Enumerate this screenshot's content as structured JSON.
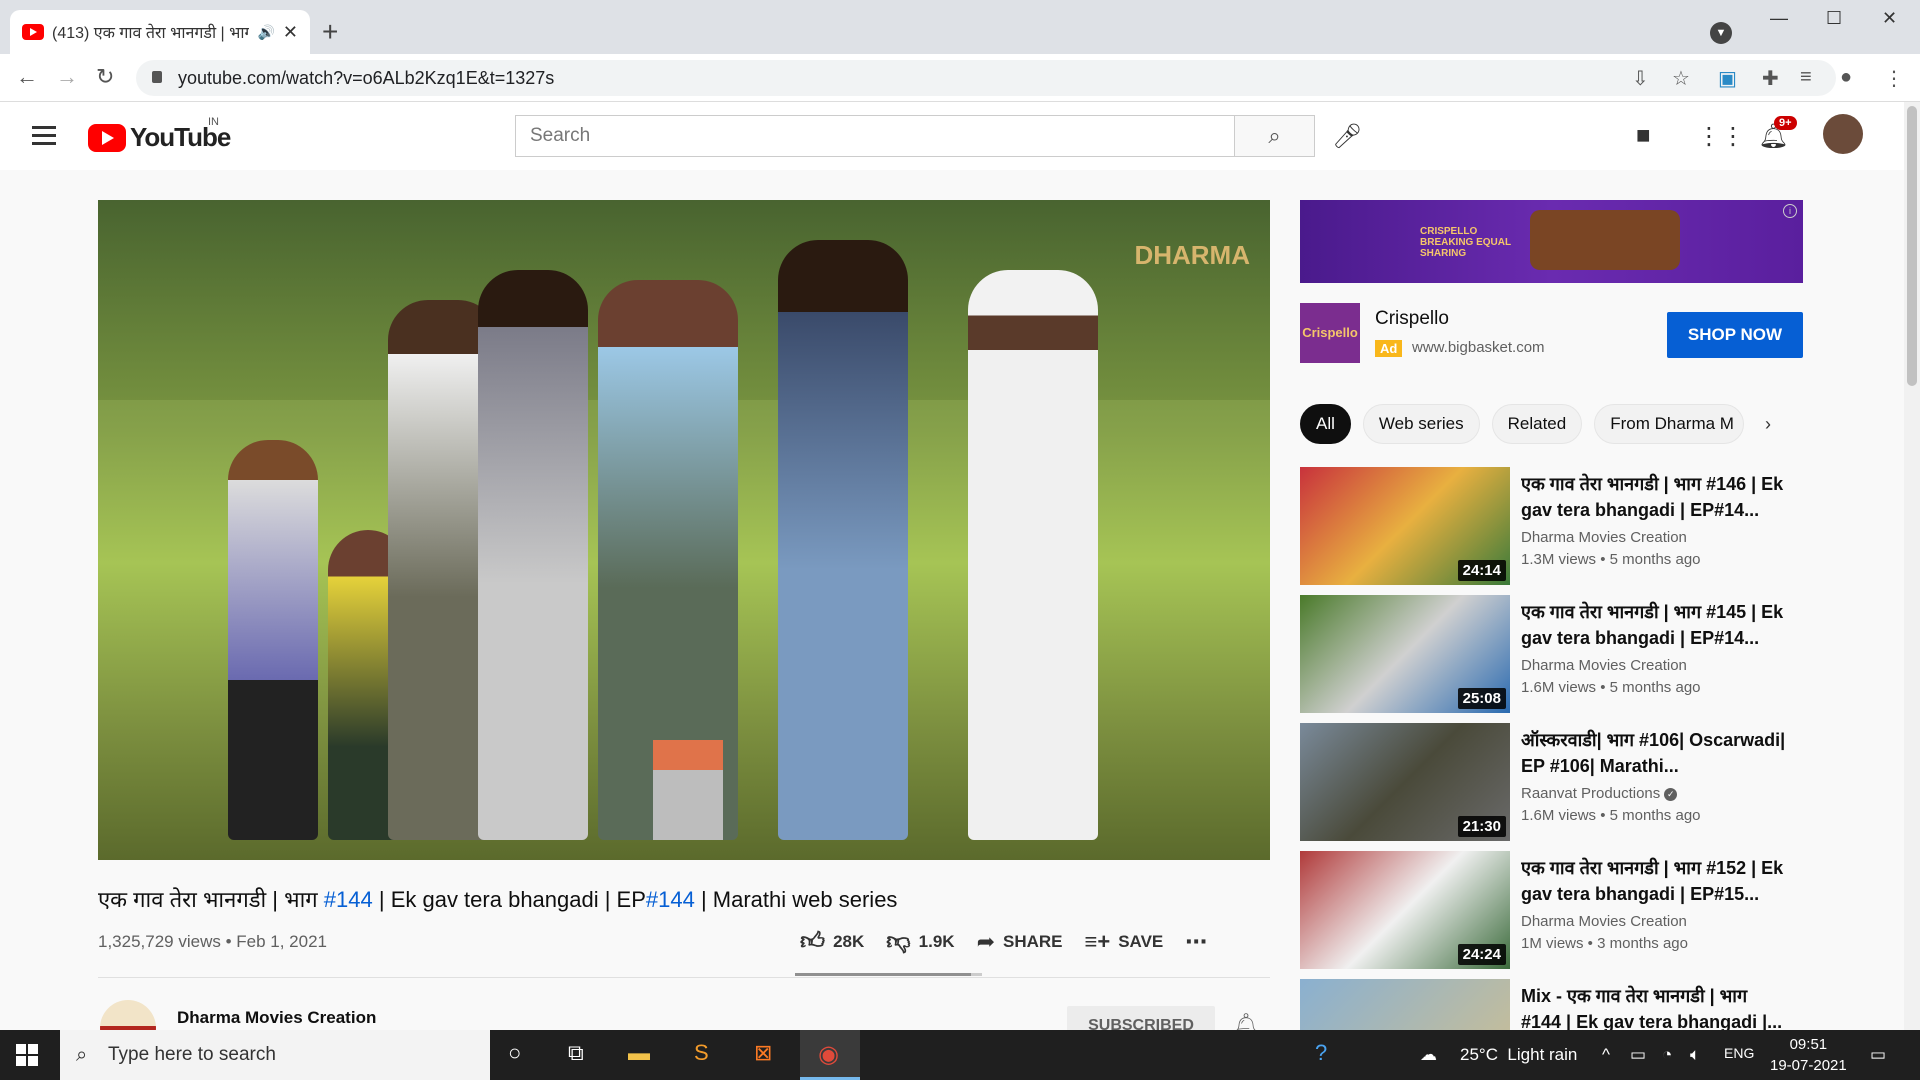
{
  "browser": {
    "tab_title": "(413) एक गाव तेरा भानगडी | भाग",
    "url": "youtube.com/watch?v=o6ALb2Kzq1E&t=1327s"
  },
  "header": {
    "logo_text": "YouTube",
    "region": "IN",
    "search_placeholder": "Search",
    "notification_count": "9+"
  },
  "video": {
    "watermark": "DHARMA",
    "title_part1": "एक गाव तेरा भानगडी | भाग ",
    "title_link1": "#144",
    "title_part2": " | Ek gav tera bhangadi | EP",
    "title_link2": "#144",
    "title_part3": " | Marathi web series",
    "meta": "1,325,729 views • Feb 1, 2021",
    "likes": "28K",
    "dislikes": "1.9K",
    "share_label": "SHARE",
    "save_label": "SAVE",
    "channel_name": "Dharma Movies Creation",
    "subscribe_label": "SUBSCRIBED"
  },
  "ad": {
    "banner_text": "CRISPELLO BREAKING EQUAL SHARING",
    "brand": "Crispello",
    "logo_text": "Crispello",
    "badge": "Ad",
    "url": "www.bigbasket.com",
    "cta": "SHOP NOW"
  },
  "chips": [
    "All",
    "Web series",
    "Related",
    "From Dharma M"
  ],
  "recommendations": [
    {
      "title": "एक गाव तेरा भानगडी | भाग #146 | Ek gav tera bhangadi | EP#14...",
      "channel": "Dharma Movies Creation",
      "views": "1.3M views • 5 months ago",
      "duration": "24:14"
    },
    {
      "title": "एक गाव तेरा भानगडी | भाग #145 | Ek gav tera bhangadi | EP#14...",
      "channel": "Dharma Movies Creation",
      "views": "1.6M views • 5 months ago",
      "duration": "25:08"
    },
    {
      "title": "ऑस्करवाडी| भाग #106| Oscarwadi| EP #106| Marathi...",
      "channel": "Raanvat Productions",
      "views": "1.6M views • 5 months ago",
      "duration": "21:30"
    },
    {
      "title": "एक गाव तेरा भानगडी | भाग #152 | Ek gav tera bhangadi | EP#15...",
      "channel": "Dharma Movies Creation",
      "views": "1M views • 3 months ago",
      "duration": "24:24"
    },
    {
      "title": "Mix - एक गाव तेरा भानगडी | भाग #144 | Ek gav tera bhangadi |...",
      "channel": "",
      "views": "",
      "duration": ""
    }
  ],
  "taskbar": {
    "search_placeholder": "Type here to search",
    "weather": "25°C  Light rain",
    "lang": "ENG",
    "time": "09:51",
    "date": "19-07-2021"
  },
  "colors": {
    "youtube_red": "#ff0000",
    "link_blue": "#065fd4"
  }
}
